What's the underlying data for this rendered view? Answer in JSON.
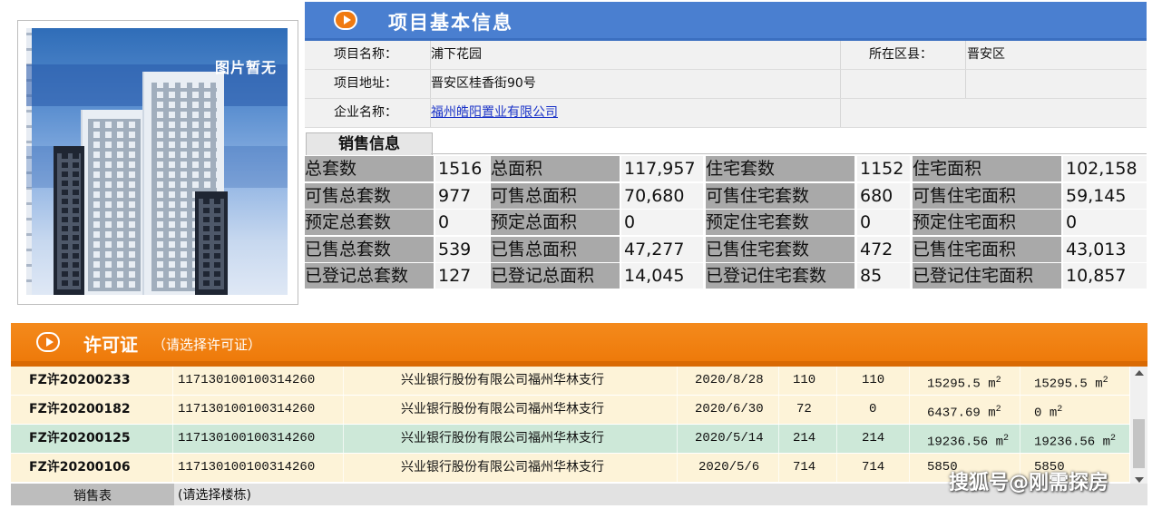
{
  "photo": {
    "label": "图片暂无"
  },
  "header": {
    "title": "项目基本信息"
  },
  "info": {
    "name_label": "项目名称：",
    "name_value": "浦下花园",
    "county_label": "所在区县：",
    "county_value": "晋安区",
    "address_label": "项目地址：",
    "address_value": "晋安区桂香街90号",
    "company_label": "企业名称：",
    "company_value": "福州皓阳置业有限公司"
  },
  "sales": {
    "tab_label": "销售信息",
    "rows": [
      [
        "总套数",
        "1516",
        "总面积",
        "117,957",
        "住宅套数",
        "1152",
        "住宅面积",
        "102,158"
      ],
      [
        "可售总套数",
        "977",
        "可售总面积",
        "70,680",
        "可售住宅套数",
        "680",
        "可售住宅面积",
        "59,145"
      ],
      [
        "预定总套数",
        "0",
        "预定总面积",
        "0",
        "预定住宅套数",
        "0",
        "预定住宅面积",
        "0"
      ],
      [
        "已售总套数",
        "539",
        "已售总面积",
        "47,277",
        "已售住宅套数",
        "472",
        "已售住宅面积",
        "43,013"
      ],
      [
        "已登记总套数",
        "127",
        "已登记总面积",
        "14,045",
        "已登记住宅套数",
        "85",
        "已登记住宅面积",
        "10,857"
      ]
    ]
  },
  "permit": {
    "title": "许可证",
    "subtitle": "（请选择许可证）",
    "area_unit": "m",
    "area_exp": "2",
    "rows": [
      {
        "id": "FZ许20200233",
        "account": "117130100100314260",
        "bank": "兴业银行股份有限公司福州华林支行",
        "date": "2020/8/28",
        "total": "110",
        "avail": "110",
        "area1": "15295.5 ",
        "area2": "15295.5 ",
        "bg": "#fdf3d8"
      },
      {
        "id": "FZ许20200182",
        "account": "117130100100314260",
        "bank": "兴业银行股份有限公司福州华林支行",
        "date": "2020/6/30",
        "total": "72",
        "avail": "0",
        "area1": "6437.69 ",
        "area2": "0 ",
        "bg": "#fdf3d8"
      },
      {
        "id": "FZ许20200125",
        "account": "117130100100314260",
        "bank": "兴业银行股份有限公司福州华林支行",
        "date": "2020/5/14",
        "total": "214",
        "avail": "214",
        "area1": "19236.56 ",
        "area2": "19236.56 ",
        "bg": "#cde8d8"
      },
      {
        "id": "FZ许20200106",
        "account": "117130100100314260",
        "bank": "兴业银行股份有限公司福州华林支行",
        "date": "2020/5/6",
        "total": "714",
        "avail": "714",
        "area1": "5850",
        "area2": "5850",
        "bg": "#fdf3d8"
      }
    ]
  },
  "bottom": {
    "table_label": "销售表",
    "select_hint": "(请选择楼栋)"
  },
  "watermark": "搜狐号@刚需探房",
  "colors": {
    "header_blue": "#4a7fd0",
    "header_orange": "#f07a10",
    "link": "#1a33c8"
  }
}
